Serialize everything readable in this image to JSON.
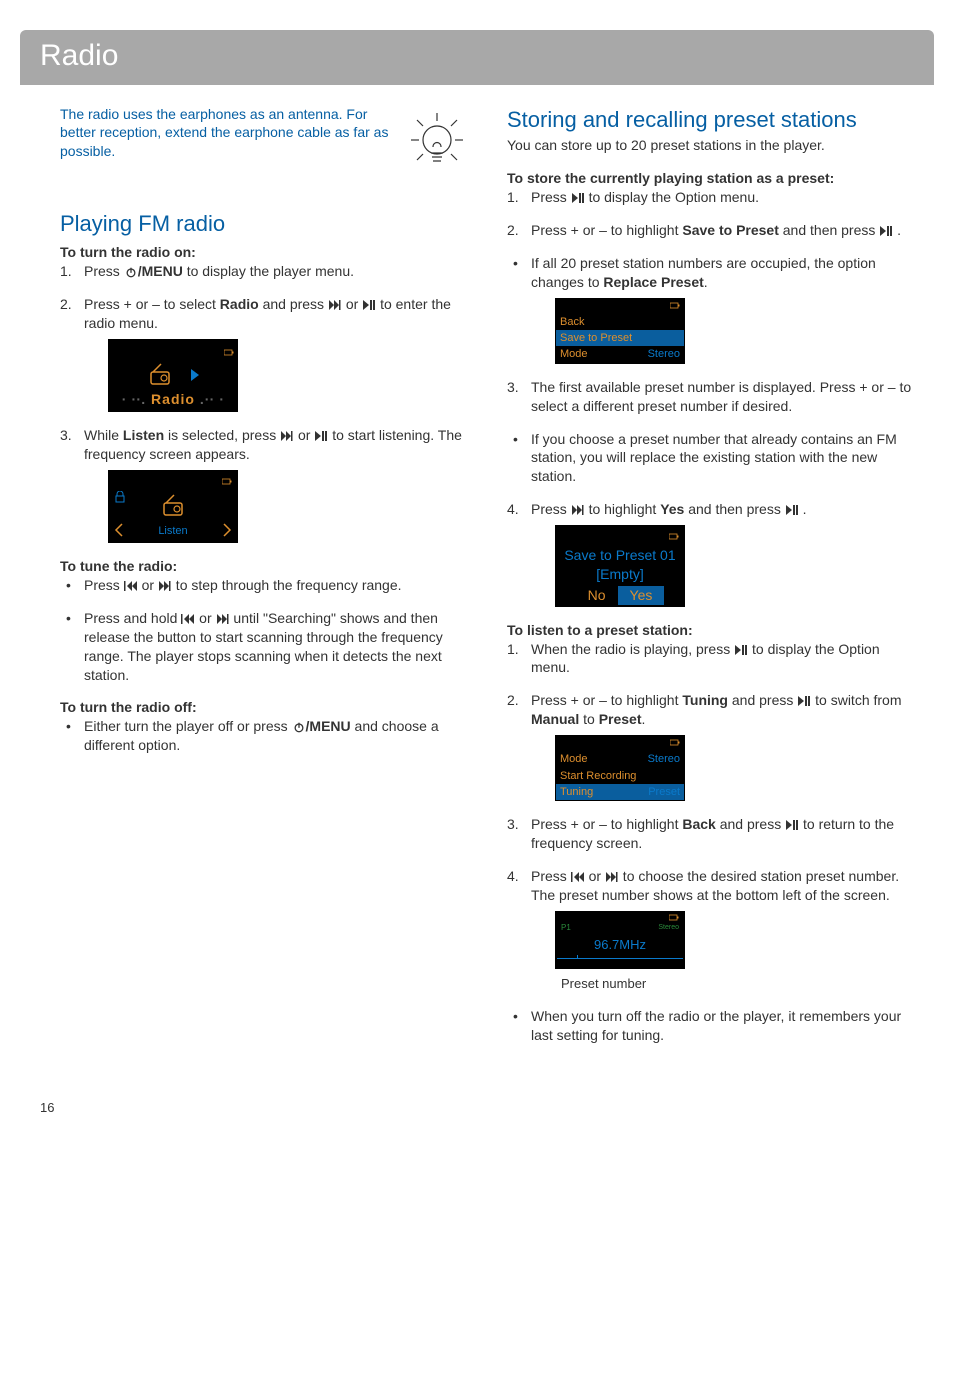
{
  "header": {
    "title": "Radio"
  },
  "intro": {
    "text": "The radio uses the earphones as an antenna. For better reception, extend the earphone cable as far as possible."
  },
  "left": {
    "section1_title": "Playing FM radio",
    "turn_on_head": "To turn the radio on:",
    "step1_num": "1.",
    "step1_a": "Press ",
    "step1_b": "/MENU",
    "step1_c": " to display the player menu.",
    "step2_num": "2.",
    "step2_a": "Press + or – to select ",
    "step2_b": "Radio",
    "step2_c": " and press ",
    "step2_d": " or ",
    "step2_e": " to enter the radio menu.",
    "radio_screen_label": "Radio",
    "step3_num": "3.",
    "step3_a": "While ",
    "step3_b": "Listen",
    "step3_c": " is selected, press ",
    "step3_d": " or ",
    "step3_e": " to start listening. The frequency screen appears.",
    "listen_label": "Listen",
    "tune_head": "To tune the radio:",
    "tune_b1_a": "Press ",
    "tune_b1_b": " or ",
    "tune_b1_c": " to step through the frequency range.",
    "tune_b2_a": "Press and hold ",
    "tune_b2_b": " or ",
    "tune_b2_c": " until \"Searching\" shows and then release the button to start scanning through the frequency range. The player stops scanning when it detects the next station.",
    "turn_off_head": "To turn the radio off:",
    "off_b1_a": "Either turn the player off or press ",
    "off_b1_b": "/MENU",
    "off_b1_c": " and choose a different option."
  },
  "right": {
    "section2_title": "Storing and recalling preset stations",
    "section2_intro": "You can store up to 20 preset stations in the player.",
    "store_head": "To store the currently playing station as a preset:",
    "s1_num": "1.",
    "s1_a": "Press ",
    "s1_b": " to display the Option menu.",
    "s2_num": "2.",
    "s2_a": "Press + or – to highlight ",
    "s2_b": "Save to Preset",
    "s2_c": " and then press ",
    "s2_d": " .",
    "s2_bullet_a": "If all 20 preset station numbers are occupied, the option changes to ",
    "s2_bullet_b": "Replace Preset",
    "s2_bullet_c": ".",
    "screenA_back": "Back",
    "screenA_save": "Save to Preset",
    "screenA_mode": "Mode",
    "screenA_stereo": "Stereo",
    "s3_num": "3.",
    "s3_a": "The first available preset number is displayed. Press + or – to select a different preset number if desired.",
    "s3_bullet": "If you choose a preset number that already contains an FM station, you will replace the existing station with the new station.",
    "s4_num": "4.",
    "s4_a": "Press ",
    "s4_b": " to highlight ",
    "s4_c": "Yes",
    "s4_d": " and then press ",
    "s4_e": " .",
    "screenB_line1": "Save to Preset 01",
    "screenB_line2": "[Empty]",
    "screenB_no": "No",
    "screenB_yes": "Yes",
    "listen_head": "To listen to a preset station:",
    "l1_num": "1.",
    "l1_a": "When the radio is playing, press ",
    "l1_b": " to display the Option menu.",
    "l2_num": "2.",
    "l2_a": "Press + or – to highlight ",
    "l2_b": "Tuning",
    "l2_c": " and press ",
    "l2_d": " to switch from ",
    "l2_e": "Manual",
    "l2_f": " to ",
    "l2_g": "Preset",
    "l2_h": ".",
    "screenC_mode": "Mode",
    "screenC_stereo": "Stereo",
    "screenC_start": "Start Recording",
    "screenC_tuning": "Tuning",
    "screenC_preset": "Preset",
    "l3_num": "3.",
    "l3_a": "Press + or – to highlight ",
    "l3_b": "Back",
    "l3_c": " and press ",
    "l3_d": " to return to the frequency screen.",
    "l4_num": "4.",
    "l4_a": "Press ",
    "l4_b": " or ",
    "l4_c": " to choose the desired station preset number. The preset number shows at the bottom left of the screen.",
    "screenD_p1": "P1",
    "screenD_stereo": "Stereo",
    "screenD_freq": "96.7MHz",
    "screenD_caption": "Preset number",
    "final_bullet": "When you turn off the radio or the player, it remembers your last setting for tuning."
  },
  "page_number": "16"
}
